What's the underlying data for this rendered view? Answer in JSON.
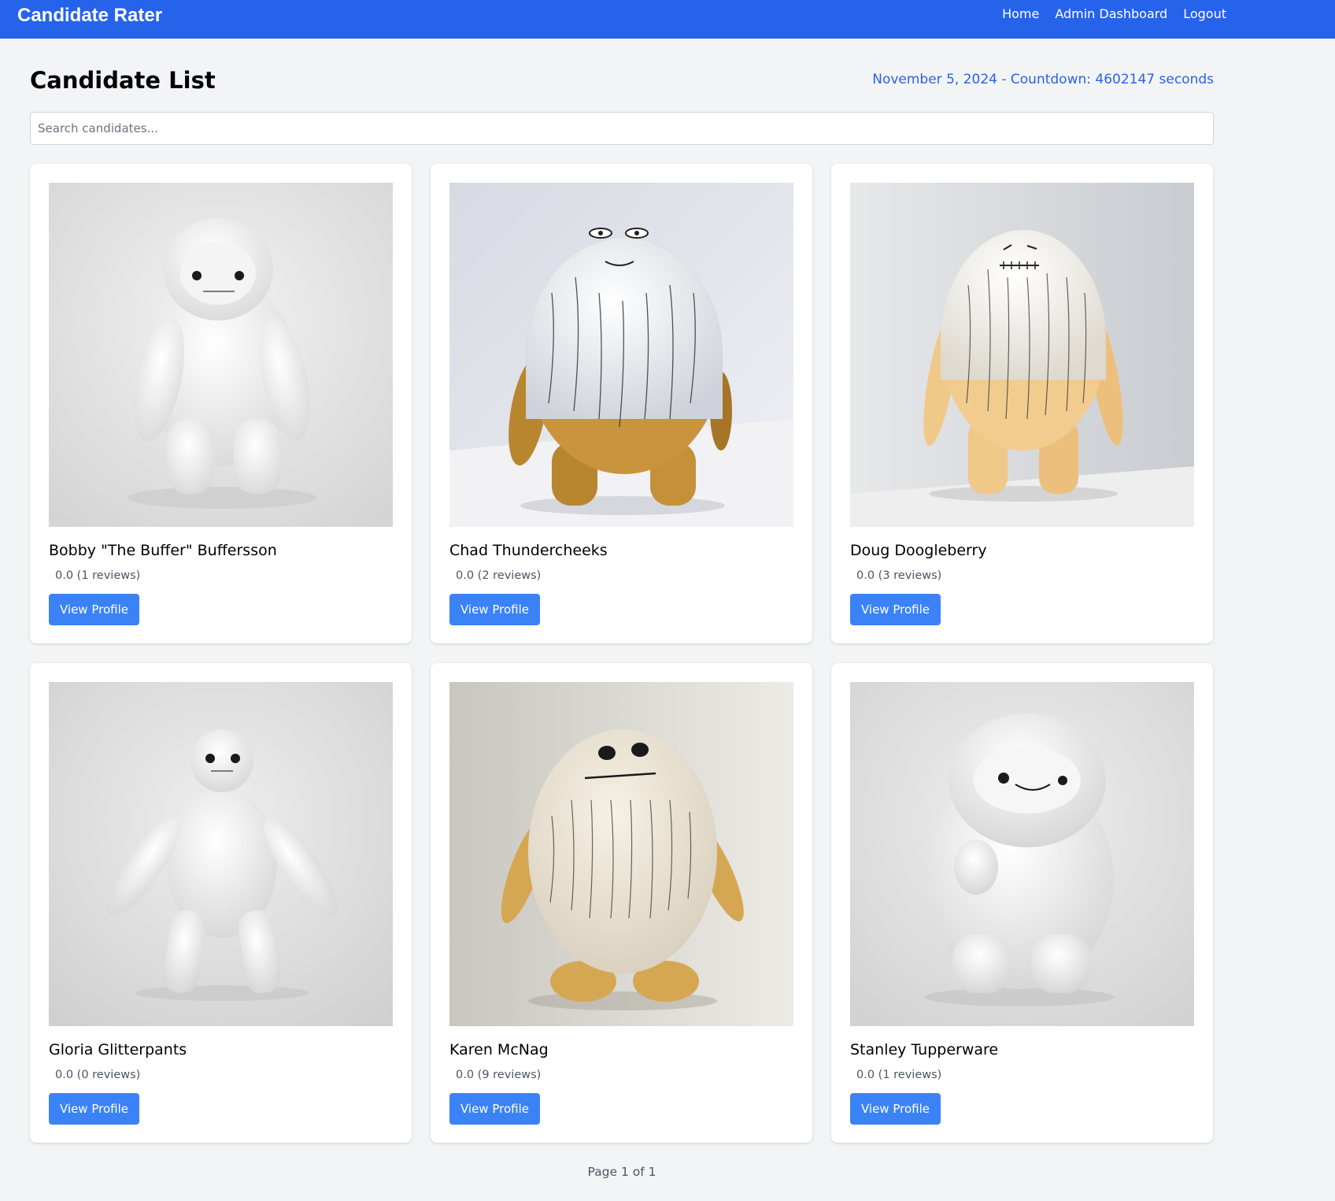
{
  "nav": {
    "brand": "Candidate Rater",
    "links": [
      "Home",
      "Admin Dashboard",
      "Logout"
    ]
  },
  "header": {
    "title": "Candidate List",
    "countdown": "November 5, 2024 - Countdown: 4602147 seconds"
  },
  "search": {
    "placeholder": "Search candidates...",
    "value": ""
  },
  "candidates": [
    {
      "name": "Bobby \"The Buffer\" Buffersson",
      "rating": "0.0 (1 reviews)",
      "button": "View Profile",
      "image": "white-fluffy-yeti-figure"
    },
    {
      "name": "Chad Thundercheeks",
      "rating": "0.0 (2 reviews)",
      "button": "View Profile",
      "image": "egg-shaped-hairy-figure"
    },
    {
      "name": "Doug Doogleberry",
      "rating": "0.0 (3 reviews)",
      "button": "View Profile",
      "image": "tall-hairy-figure"
    },
    {
      "name": "Gloria Glitterpants",
      "rating": "0.0 (0 reviews)",
      "button": "View Profile",
      "image": "white-fluffy-yeti-figure"
    },
    {
      "name": "Karen McNag",
      "rating": "0.0 (9 reviews)",
      "button": "View Profile",
      "image": "egg-shaped-hairy-figure"
    },
    {
      "name": "Stanley Tupperware",
      "rating": "0.0 (1 reviews)",
      "button": "View Profile",
      "image": "white-fluffy-yeti-figure"
    }
  ],
  "pagination": {
    "text": "Page 1 of 1"
  },
  "colors": {
    "navbar": "#2563eb",
    "accent": "#3b82f6",
    "background": "#f3f4f6"
  }
}
